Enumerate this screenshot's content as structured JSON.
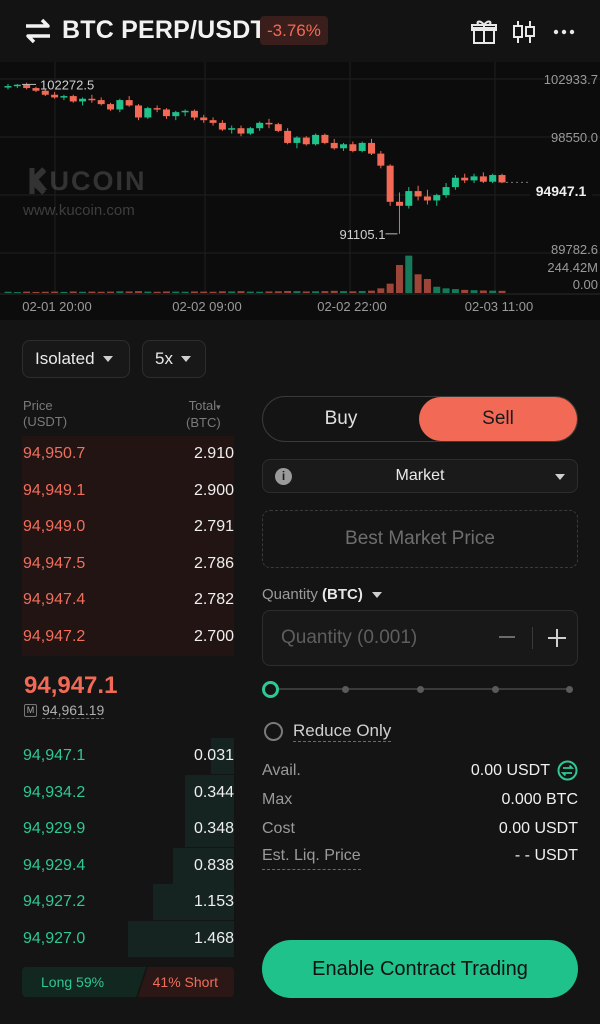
{
  "header": {
    "pair": "BTC PERP/USDT",
    "change": "-3.76%",
    "icons": [
      "swap-arrows-icon",
      "gift-icon",
      "candlestick-icon",
      "more-icon"
    ]
  },
  "chart": {
    "watermark_brand": "KUCOIN",
    "watermark_url": "www.kucoin.com",
    "high_label": "102272.5",
    "low_label": "91105.1",
    "last_price": "94947.1",
    "y_ticks": [
      "102933.7",
      "98550.0",
      "89782.6"
    ],
    "volume_ticks": [
      "244.42M",
      "0.00"
    ],
    "x_ticks": [
      "02-01 20:00",
      "02-02 09:00",
      "02-02 22:00",
      "02-03 11:00"
    ],
    "candles": [
      [
        102100,
        102300,
        101900,
        102150
      ],
      [
        102150,
        102300,
        102000,
        102250
      ],
      [
        102250,
        102400,
        101900,
        102000
      ],
      [
        102000,
        102100,
        101700,
        101800
      ],
      [
        101800,
        101950,
        101400,
        101500
      ],
      [
        101500,
        101700,
        101200,
        101300
      ],
      [
        101300,
        101500,
        101100,
        101400
      ],
      [
        101400,
        101500,
        100900,
        101000
      ],
      [
        101000,
        101300,
        100700,
        101200
      ],
      [
        101200,
        101500,
        100900,
        101100
      ],
      [
        101100,
        101300,
        100700,
        100800
      ],
      [
        100800,
        100900,
        100300,
        100400
      ],
      [
        100400,
        101200,
        100200,
        101100
      ],
      [
        101100,
        101400,
        100600,
        100700
      ],
      [
        100700,
        100800,
        99600,
        99800
      ],
      [
        99800,
        100600,
        99700,
        100500
      ],
      [
        100500,
        100700,
        100200,
        100400
      ],
      [
        100400,
        100500,
        99700,
        99900
      ],
      [
        99900,
        100300,
        99600,
        100200
      ],
      [
        100200,
        100400,
        99900,
        100300
      ],
      [
        100300,
        100400,
        99600,
        99800
      ],
      [
        99800,
        100000,
        99400,
        99600
      ],
      [
        99600,
        99800,
        99200,
        99400
      ],
      [
        99400,
        99600,
        98800,
        98900
      ],
      [
        98900,
        99200,
        98600,
        99000
      ],
      [
        99000,
        99200,
        98400,
        98600
      ],
      [
        98600,
        99100,
        98500,
        99000
      ],
      [
        99000,
        99500,
        98800,
        99400
      ],
      [
        99400,
        99700,
        99000,
        99300
      ],
      [
        99300,
        99400,
        98700,
        98800
      ],
      [
        98800,
        99000,
        97800,
        97900
      ],
      [
        97900,
        98400,
        97500,
        98300
      ],
      [
        98300,
        98400,
        97700,
        97800
      ],
      [
        97800,
        98600,
        97700,
        98500
      ],
      [
        98500,
        98600,
        97800,
        97900
      ],
      [
        97900,
        98200,
        97400,
        97500
      ],
      [
        97500,
        97900,
        97300,
        97800
      ],
      [
        97800,
        98000,
        97200,
        97300
      ],
      [
        97300,
        98000,
        97200,
        97900
      ],
      [
        97900,
        98200,
        97000,
        97100
      ],
      [
        97100,
        97300,
        96000,
        96200
      ],
      [
        96200,
        96300,
        93200,
        93500
      ],
      [
        93500,
        94200,
        91105,
        93200
      ],
      [
        93200,
        94600,
        93000,
        94300
      ],
      [
        94300,
        94700,
        93600,
        93900
      ],
      [
        93900,
        94400,
        93300,
        93600
      ],
      [
        93600,
        94100,
        93200,
        94000
      ],
      [
        94000,
        94900,
        93800,
        94600
      ],
      [
        94600,
        95500,
        94400,
        95300
      ],
      [
        95300,
        95600,
        94900,
        95100
      ],
      [
        95100,
        95600,
        94900,
        95400
      ],
      [
        95400,
        95700,
        94900,
        95000
      ],
      [
        95000,
        95600,
        94900,
        95500
      ],
      [
        95500,
        95600,
        94900,
        94947.1
      ]
    ],
    "volumes": [
      8,
      6,
      9,
      7,
      8,
      9,
      7,
      10,
      8,
      9,
      8,
      9,
      11,
      10,
      12,
      9,
      8,
      10,
      9,
      8,
      10,
      9,
      8,
      11,
      10,
      12,
      9,
      8,
      10,
      11,
      13,
      12,
      10,
      11,
      12,
      14,
      12,
      11,
      13,
      15,
      30,
      60,
      180,
      240,
      120,
      90,
      40,
      30,
      25,
      20,
      18,
      16,
      15,
      14
    ],
    "colors": {
      "up": "#1fc28a",
      "down": "#f26a55"
    }
  },
  "controls": {
    "margin_mode": "Isolated",
    "leverage": "5x"
  },
  "orderbook": {
    "price_header": "Price",
    "price_unit": "(USDT)",
    "total_header": "Total",
    "total_unit": "(BTC)",
    "asks": [
      {
        "price": "94,950.7",
        "qty": "2.910"
      },
      {
        "price": "94,949.1",
        "qty": "2.900"
      },
      {
        "price": "94,949.0",
        "qty": "2.791"
      },
      {
        "price": "94,947.5",
        "qty": "2.786"
      },
      {
        "price": "94,947.4",
        "qty": "2.782"
      },
      {
        "price": "94,947.2",
        "qty": "2.700"
      }
    ],
    "last_price": "94,947.1",
    "mark_label": "M",
    "mark_price": "94,961.19",
    "bids": [
      {
        "price": "94,947.1",
        "qty": "0.031",
        "depth": 0.11
      },
      {
        "price": "94,934.2",
        "qty": "0.344",
        "depth": 0.23
      },
      {
        "price": "94,929.9",
        "qty": "0.348",
        "depth": 0.23
      },
      {
        "price": "94,929.4",
        "qty": "0.838",
        "depth": 0.29
      },
      {
        "price": "94,927.2",
        "qty": "1.153",
        "depth": 0.38
      },
      {
        "price": "94,927.0",
        "qty": "1.468",
        "depth": 0.5
      }
    ],
    "long_label": "Long 59%",
    "short_label": "41% Short"
  },
  "order_form": {
    "buy_label": "Buy",
    "sell_label": "Sell",
    "order_type": "Market",
    "best_market_price": "Best Market Price",
    "quantity_label": "Quantity",
    "quantity_unit": "(BTC)",
    "quantity_placeholder": "Quantity (0.001)",
    "slider_value": 0,
    "reduce_only": "Reduce Only",
    "avail_label": "Avail.",
    "avail_value": "0.00 USDT",
    "max_label": "Max",
    "max_value": "0.000 BTC",
    "cost_label": "Cost",
    "cost_value": "0.00 USDT",
    "liq_label": "Est. Liq. Price",
    "liq_value": "- - USDT",
    "enable_button": "Enable Contract Trading"
  }
}
